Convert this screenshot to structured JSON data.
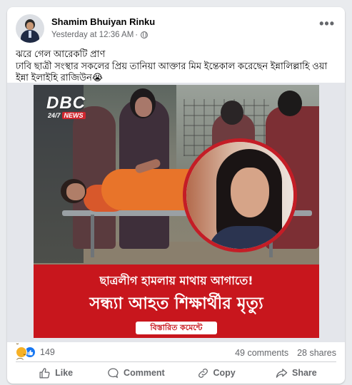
{
  "post": {
    "author": "Shamim Bhuiyan Rinku",
    "timestamp": "Yesterday at 12:36 AM",
    "separator": "·",
    "privacy_icon": "globe-icon",
    "more_icon": "•••",
    "text_lines": [
      "ঝরে গেল আরেকটি প্রাণ",
      "ঢাবি ছাত্রী সংস্থার সকলের প্রিয় তানিয়া আক্তার মিম ইন্তেকাল করেছেন  ইন্নালিল্লাহি ওয়া",
      "ইন্না ইলাইহি রাজিউন😭"
    ]
  },
  "image": {
    "logo_main": "DBC",
    "logo_sub_left": "24/7",
    "logo_sub_right": "NEWS",
    "banner_top": "ছাত্রলীগ হামলায় মাথায় আগাতে!",
    "banner_main": "সন্ধ্যা আহত শিক্ষার্থীর মৃত্যু",
    "banner_pill": "বিস্তারিত কমেন্টে",
    "banner_color": "#c8161d"
  },
  "stats": {
    "reactions": "149",
    "reaction_icons": [
      "sad-emoji",
      "like-thumb"
    ],
    "comments": "49 comments",
    "shares": "28 shares"
  },
  "actions": {
    "like": "Like",
    "comment": "Comment",
    "copy": "Copy",
    "share": "Share"
  },
  "colors": {
    "accent": "#1877f2",
    "muted_text": "#65676b",
    "background": "#e9ebee"
  }
}
